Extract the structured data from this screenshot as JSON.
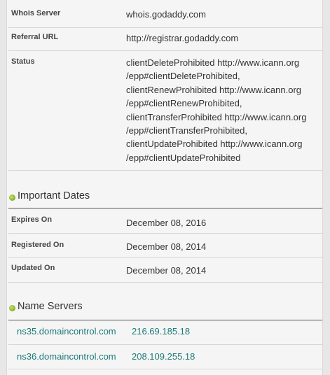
{
  "colors": {
    "background": "#e7e7e7",
    "panel": "#f5f5f5",
    "link": "#1f7a7a",
    "section_dot": "#8bb52d"
  },
  "whois": {
    "rows": [
      {
        "label": "Whois Server",
        "value": "whois.godaddy.com"
      },
      {
        "label": "Referral URL",
        "value": "http://registrar.godaddy.com"
      }
    ],
    "status": {
      "label": "Status",
      "lines": [
        "clientDeleteProhibited http://www.icann.org",
        "/epp#clientDeleteProhibited,",
        "clientRenewProhibited http://www.icann.org",
        "/epp#clientRenewProhibited,",
        "clientTransferProhibited http://www.icann.org",
        "/epp#clientTransferProhibited,",
        "clientUpdateProhibited http://www.icann.org",
        "/epp#clientUpdateProhibited"
      ]
    }
  },
  "important_dates": {
    "title": "Important Dates",
    "rows": [
      {
        "label": "Expires On",
        "value": "December 08, 2016"
      },
      {
        "label": "Registered On",
        "value": "December 08, 2014"
      },
      {
        "label": "Updated On",
        "value": "December 08, 2014"
      }
    ]
  },
  "name_servers": {
    "title": "Name Servers",
    "rows": [
      {
        "host": "ns35.domaincontrol.com",
        "ip": "216.69.185.18"
      },
      {
        "host": "ns36.domaincontrol.com",
        "ip": "208.109.255.18"
      }
    ]
  }
}
